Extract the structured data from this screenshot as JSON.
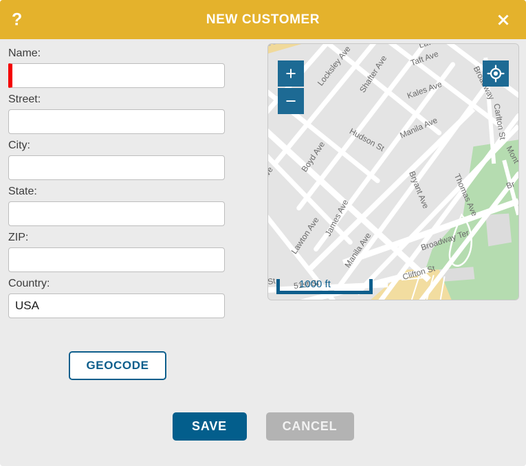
{
  "titlebar": {
    "help_label": "?",
    "title": "NEW CUSTOMER",
    "close_label": "✕"
  },
  "form": {
    "fields": [
      {
        "label": "Name:",
        "value": "",
        "placeholder": "",
        "required": true
      },
      {
        "label": "Street:",
        "value": "",
        "placeholder": "",
        "required": false
      },
      {
        "label": "City:",
        "value": "",
        "placeholder": "",
        "required": false
      },
      {
        "label": "State:",
        "value": "",
        "placeholder": "",
        "required": false
      },
      {
        "label": "ZIP:",
        "value": "",
        "placeholder": "",
        "required": false
      },
      {
        "label": "Country:",
        "value": "USA",
        "placeholder": "",
        "required": false
      }
    ],
    "geocode_label": "GEOCODE"
  },
  "map": {
    "zoom_in_label": "+",
    "zoom_out_label": "−",
    "locate_icon": "locate-crosshair-icon",
    "scale_label": "1000 ft",
    "streets": [
      "Locksley Ave",
      "Shafter Ave",
      "Boyd Ave",
      "Hudson St",
      "Lawton Ave",
      "James Ave",
      "Manila Ave",
      "Kales Ave",
      "Taft Ave",
      "Lawton",
      "Bryant Ave",
      "Thomas Ave",
      "Broadway",
      "Broadway Ter",
      "Carlton St",
      "Clifton St",
      "Richmond St",
      "51st St",
      "Mont"
    ]
  },
  "footer": {
    "save_label": "SAVE",
    "cancel_label": "CANCEL"
  },
  "colors": {
    "header": "#e4b22c",
    "accent_blue": "#035e8c",
    "map_button": "#1d6a94",
    "required_red": "#f40000",
    "cancel_gray": "#b3b3b3",
    "dialog_bg": "#ebebeb"
  }
}
